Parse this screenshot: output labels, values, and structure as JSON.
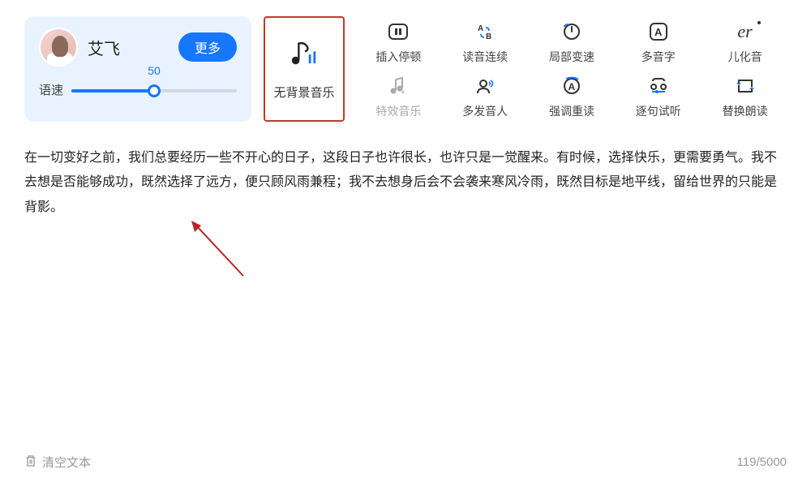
{
  "voice": {
    "name": "艾飞",
    "more_label": "更多",
    "speed_label": "语速",
    "speed_value": "50"
  },
  "bgm": {
    "label": "无背景音乐"
  },
  "tools": [
    {
      "label": "插入停顿",
      "icon": "pause-insert"
    },
    {
      "label": "读音连续",
      "icon": "continuous"
    },
    {
      "label": "局部变速",
      "icon": "local-speed"
    },
    {
      "label": "多音字",
      "icon": "polyphone"
    },
    {
      "label": "儿化音",
      "icon": "erhua"
    },
    {
      "label": "特效音乐",
      "icon": "sfx-music"
    },
    {
      "label": "多发音人",
      "icon": "multi-voice"
    },
    {
      "label": "强调重读",
      "icon": "emphasis"
    },
    {
      "label": "逐句试听",
      "icon": "sentence-preview"
    },
    {
      "label": "替换朗读",
      "icon": "replace-read"
    }
  ],
  "content": "在一切变好之前，我们总要经历一些不开心的日子，这段日子也许很长，也许只是一觉醒来。有时候，选择快乐，更需要勇气。我不去想是否能够成功，既然选择了远方，便只顾风雨兼程；我不去想身后会不会袭来寒风冷雨，既然目标是地平线，留给世界的只能是背影。",
  "footer": {
    "clear_label": "清空文本",
    "char_count": "119/5000"
  }
}
